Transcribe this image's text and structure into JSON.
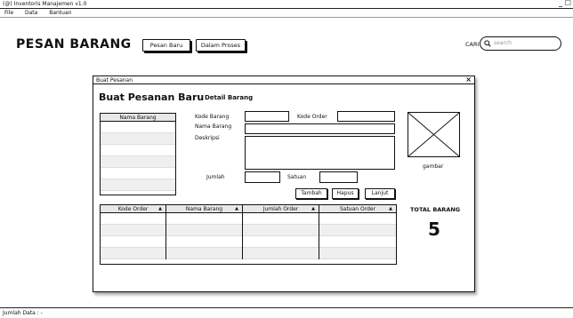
{
  "window": {
    "title": "(@) Inventoris Manajemen v1.0",
    "controls": "_ ☐"
  },
  "menu": {
    "items": [
      "File",
      "Data",
      "Bantuan"
    ]
  },
  "header": {
    "title": "PESAN BARANG",
    "tabs": [
      "Pesan Baru",
      "Dalam Proses"
    ],
    "search_label": "CARI",
    "search_placeholder": "search"
  },
  "dialog": {
    "title": "Buat Pesanan",
    "close": "×",
    "heading": "Buat Pesanan Baru",
    "subheading": "Detail Barang",
    "list_header": "Nama Barang",
    "labels": {
      "kode_barang": "Kode Barang",
      "kode_order": "Kode Order",
      "nama_barang": "Nama Barang",
      "deskripsi": "Deskripsi",
      "jumlah": "Jumlah",
      "satuan": "Satuan",
      "gambar": "gambar"
    },
    "buttons": [
      "Tambah",
      "Hapus",
      "Lanjut"
    ],
    "table": {
      "columns": [
        "Kode Order",
        "Nama Barang",
        "Jumlah Order",
        "Satuan Order"
      ],
      "sort_arrow": "▲"
    },
    "total_label": "TOTAL BARANG",
    "total_value": "5"
  },
  "status": {
    "text": "Jumlah Data : -"
  }
}
